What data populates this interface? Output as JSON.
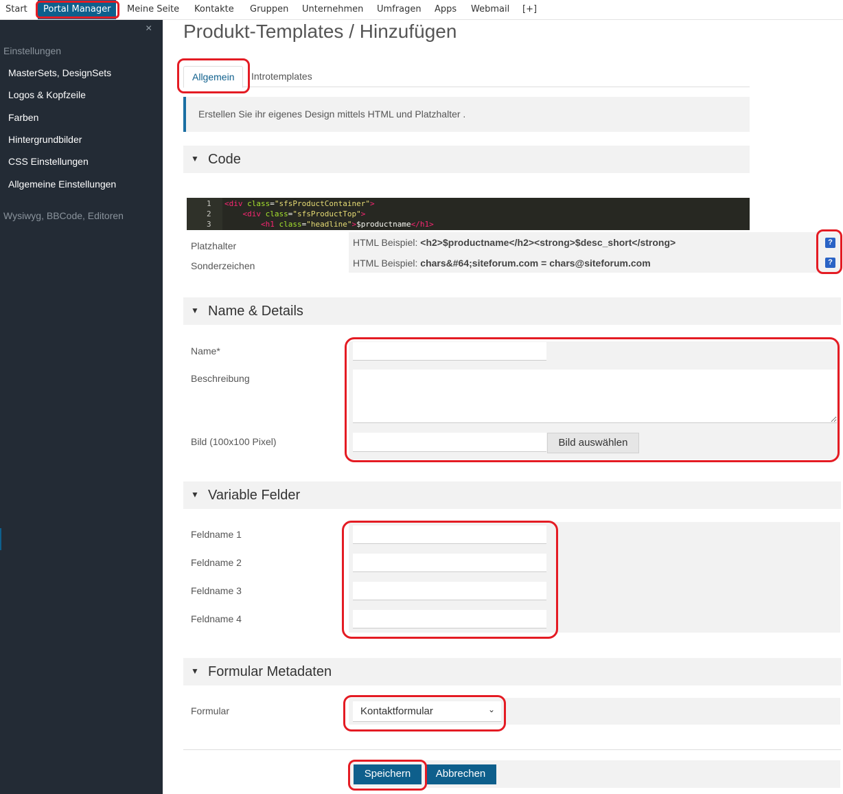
{
  "topnav": {
    "items": [
      "Start",
      "Portal Manager",
      "Meine Seite",
      "Kontakte",
      "Gruppen",
      "Unternehmen",
      "Umfragen",
      "Apps",
      "Webmail",
      "[+]"
    ]
  },
  "sidebar": {
    "close": "×",
    "category1": "Einstellungen",
    "links": [
      "MasterSets, DesignSets",
      "Logos & Kopfzeile",
      "Farben",
      "Hintergrundbilder",
      "CSS Einstellungen",
      "Allgemeine Einstellungen"
    ],
    "category2": "Wysiwyg, BBCode, Editoren"
  },
  "page": {
    "title": "Produkt-Templates / Hinzufügen",
    "tabs": [
      "Allgemein",
      "Introtemplates"
    ],
    "info": "Erstellen Sie ihr eigenes Design mittels HTML und Platzhalter ."
  },
  "sections": {
    "code": "Code",
    "details": "Name & Details",
    "variable": "Variable Felder",
    "meta": "Formular Metadaten"
  },
  "code_lines": [
    {
      "n": "1",
      "indent": "",
      "tag": "div",
      "attr": "class",
      "val": "sfsProductContainer",
      "tail": ""
    },
    {
      "n": "2",
      "indent": "    ",
      "tag": "div",
      "attr": "class",
      "val": "sfsProductTop",
      "tail": ""
    },
    {
      "n": "3",
      "indent": "        ",
      "tag": "h1",
      "attr": "class",
      "val": "headline",
      "tail": "$productname"
    }
  ],
  "hints": {
    "platzhalter_label": "Platzhalter",
    "sonderzeichen_label": "Sonderzeichen",
    "prefix": "HTML Beispiel:",
    "platzhalter_example": "<h2>$productname</h2><strong>$desc_short</strong>",
    "sonderzeichen_example": "chars&#64;siteforum.com = chars@siteforum.com",
    "help_glyph": "?"
  },
  "form": {
    "name_label": "Name*",
    "beschreibung_label": "Beschreibung",
    "bild_label": "Bild (100x100 Pixel)",
    "bild_button": "Bild auswählen",
    "feld_labels": [
      "Feldname 1",
      "Feldname 2",
      "Feldname 3",
      "Feldname 4"
    ],
    "formular_label": "Formular",
    "formular_value": "Kontaktformular",
    "save": "Speichern",
    "cancel": "Abbrechen"
  },
  "colors": {
    "accent": "#0e5f8c",
    "highlight": "#e41b23",
    "sidebar_bg": "#232b35"
  }
}
